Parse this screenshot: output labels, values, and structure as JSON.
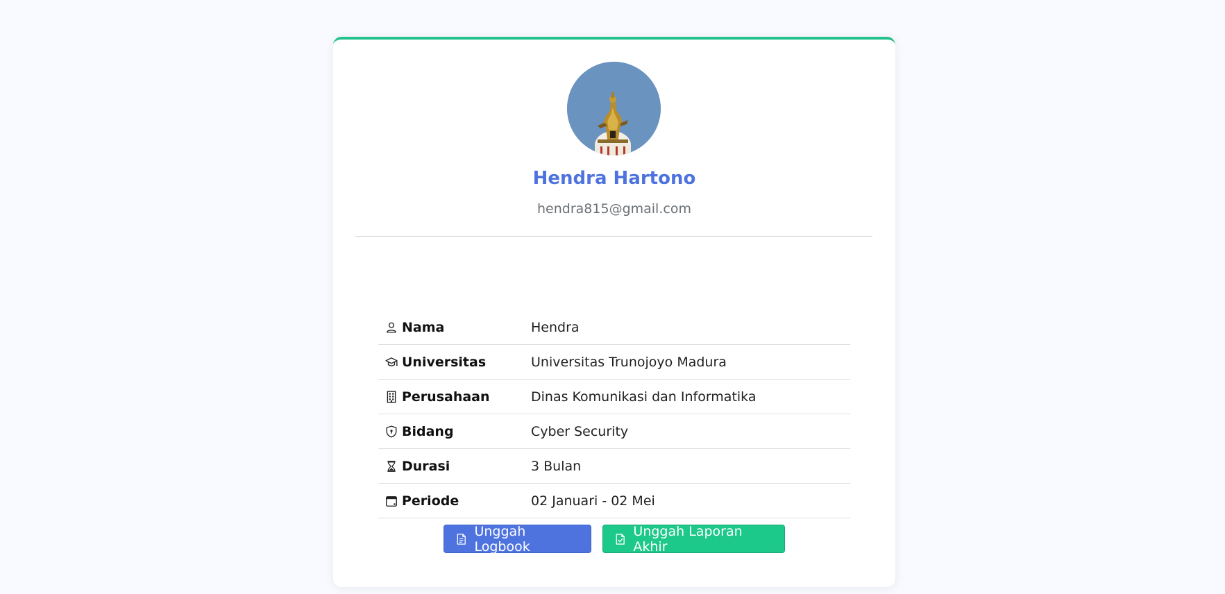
{
  "profile": {
    "name": "Hendra Hartono",
    "email": "hendra815@gmail.com",
    "avatar_icon": "profile-photo-statue"
  },
  "info": {
    "rows": [
      {
        "icon": "person-icon",
        "label": "Nama",
        "value": "Hendra"
      },
      {
        "icon": "graduation-cap-icon",
        "label": "Universitas",
        "value": "Universitas Trunojoyo Madura"
      },
      {
        "icon": "building-icon",
        "label": "Perusahaan",
        "value": "Dinas Komunikasi dan Informatika"
      },
      {
        "icon": "shield-icon",
        "label": "Bidang",
        "value": "Cyber Security"
      },
      {
        "icon": "hourglass-icon",
        "label": "Durasi",
        "value": "3 Bulan"
      },
      {
        "icon": "calendar-icon",
        "label": "Periode",
        "value": "02 Januari - 02 Mei"
      }
    ]
  },
  "actions": {
    "logbook_label": "Unggah Logbook",
    "report_label": "Unggah Laporan Akhir"
  },
  "colors": {
    "accent_blue": "#4e73df",
    "accent_green": "#1cc88a",
    "card_top_border": "#22c08a",
    "page_bg": "#f8faff"
  }
}
